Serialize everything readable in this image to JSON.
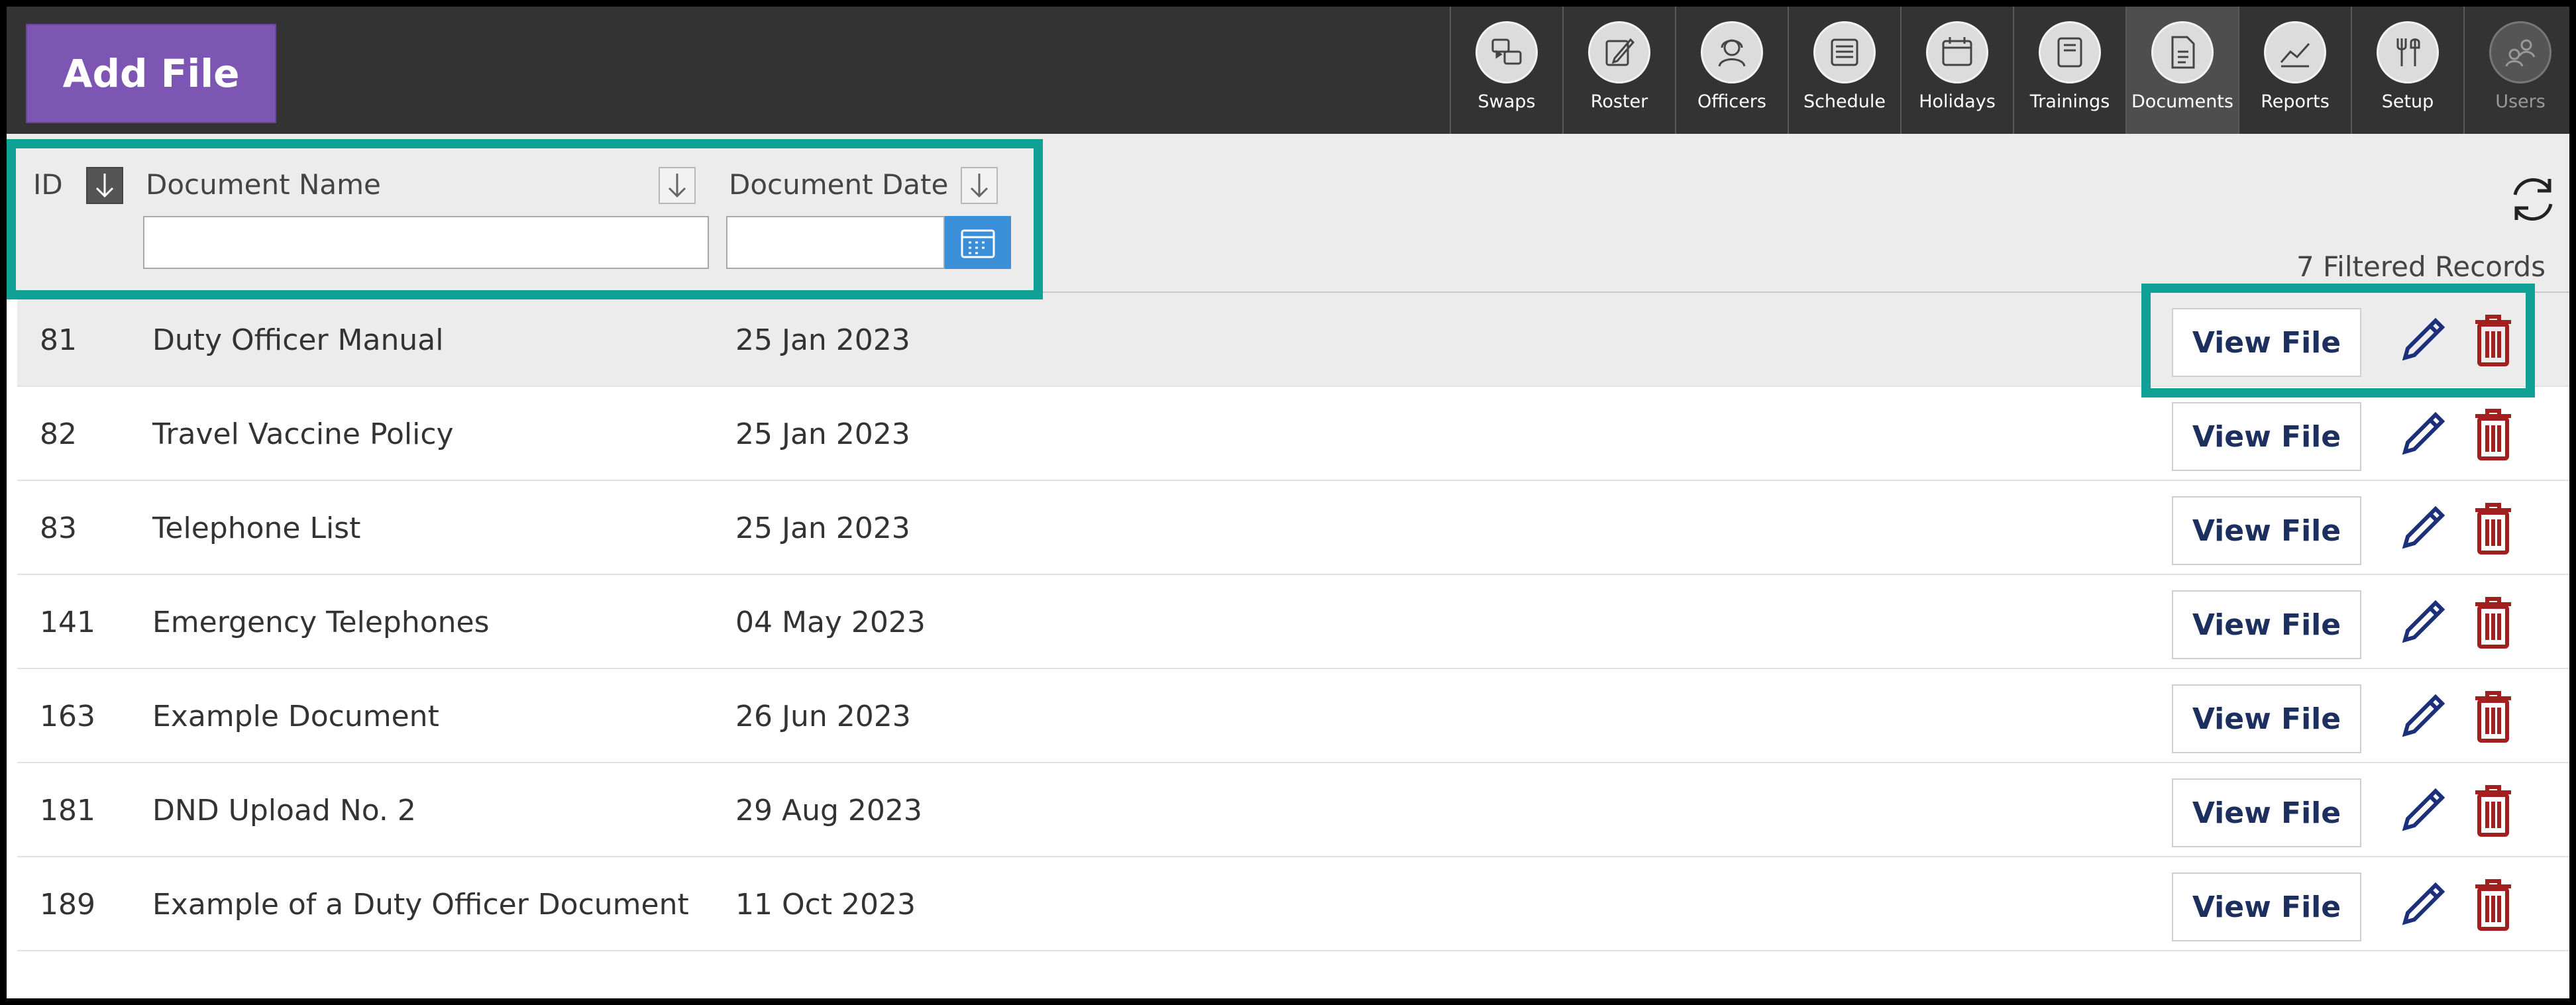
{
  "toolbar": {
    "add_file_label": "Add File",
    "nav": [
      {
        "label": "Swaps",
        "icon": "swaps-icon"
      },
      {
        "label": "Roster",
        "icon": "roster-icon"
      },
      {
        "label": "Officers",
        "icon": "officers-icon"
      },
      {
        "label": "Schedule",
        "icon": "schedule-icon"
      },
      {
        "label": "Holidays",
        "icon": "holidays-icon"
      },
      {
        "label": "Trainings",
        "icon": "trainings-icon"
      },
      {
        "label": "Documents",
        "icon": "documents-icon",
        "active": true
      },
      {
        "label": "Reports",
        "icon": "reports-icon"
      },
      {
        "label": "Setup",
        "icon": "setup-icon"
      },
      {
        "label": "Users",
        "icon": "users-icon",
        "disabled": true
      }
    ]
  },
  "filters": {
    "id_header": "ID",
    "name_header": "Document Name",
    "date_header": "Document Date",
    "name_value": "",
    "date_value": "",
    "records_label": "7 Filtered Records"
  },
  "table": {
    "view_label": "View File",
    "rows": [
      {
        "id": "81",
        "name": "Duty Officer Manual",
        "date": "25 Jan 2023"
      },
      {
        "id": "82",
        "name": "Travel Vaccine Policy",
        "date": "25 Jan 2023"
      },
      {
        "id": "83",
        "name": "Telephone List",
        "date": "25 Jan 2023"
      },
      {
        "id": "141",
        "name": "Emergency Telephones",
        "date": "04 May 2023"
      },
      {
        "id": "163",
        "name": "Example Document",
        "date": "26 Jun 2023"
      },
      {
        "id": "181",
        "name": "DND Upload No. 2",
        "date": "29 Aug 2023"
      },
      {
        "id": "189",
        "name": "Example of a Duty Officer Document",
        "date": "11 Oct 2023"
      }
    ]
  },
  "colors": {
    "accent_purple": "#7d55b2",
    "highlight_teal": "#0fa196",
    "toolbar_bg": "#333333",
    "delete_red": "#a11f1f",
    "edit_navy": "#1c2f7a",
    "calendar_blue": "#3a8fd8"
  }
}
